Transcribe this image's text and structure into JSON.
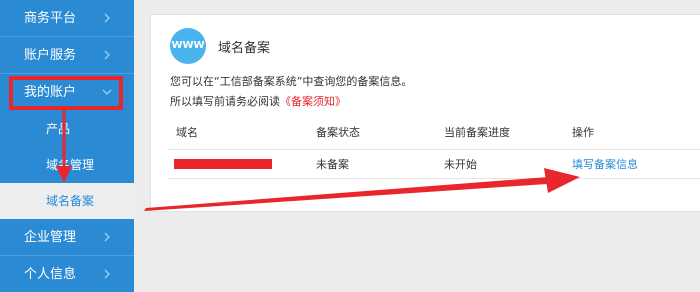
{
  "sidebar": {
    "items": [
      {
        "label": "商务平台"
      },
      {
        "label": "账户服务"
      },
      {
        "label": "我的账户"
      },
      {
        "label": "企业管理"
      },
      {
        "label": "个人信息"
      }
    ],
    "subitems": [
      {
        "label": "产品"
      },
      {
        "label": "域名管理"
      },
      {
        "label": "域名备案"
      }
    ]
  },
  "panel": {
    "badge": "WWW",
    "title": "域名备案",
    "hint_line1": "您可以在“工信部备案系统”中查询您的备案信息。",
    "hint_line2_prefix": "所以填写前请务必阅读",
    "hint_line2_link": "《备案须知》"
  },
  "table": {
    "headers": [
      "域名",
      "备案状态",
      "当前备案进度",
      "操作"
    ],
    "rows": [
      {
        "domain": "",
        "status": "未备案",
        "progress": "未开始",
        "action": "填写备案信息"
      }
    ]
  },
  "colors": {
    "sidebar": "#2a8ad4",
    "annotation": "#e8262b",
    "link": "#2a8ad4",
    "badge": "#49b3ee"
  }
}
